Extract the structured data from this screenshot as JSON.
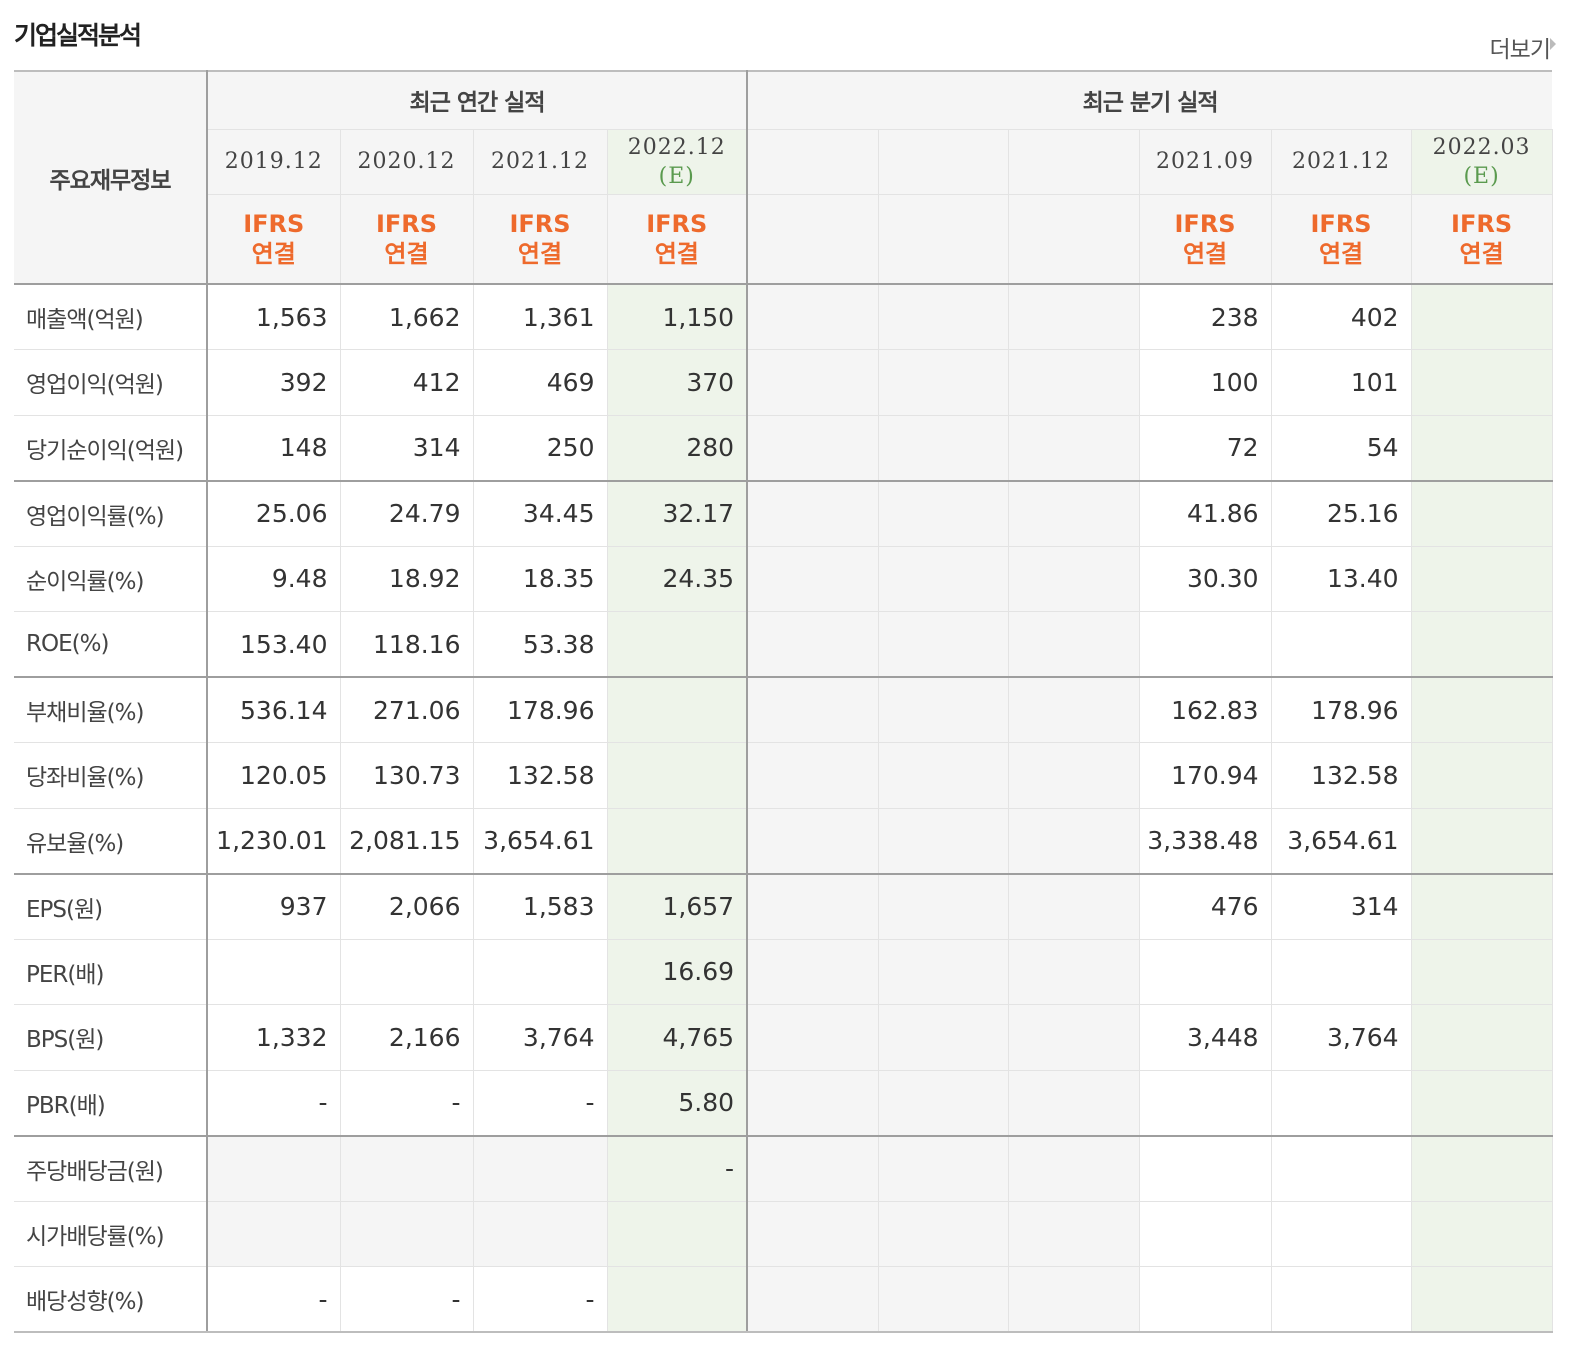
{
  "title": "기업실적분석",
  "more_label": "더보기",
  "header": {
    "corner": "주요재무정보",
    "annual_group": "최근 연간 실적",
    "quarter_group": "최근 분기 실적",
    "annual_dates": [
      {
        "date": "2019.12",
        "tag": ""
      },
      {
        "date": "2020.12",
        "tag": ""
      },
      {
        "date": "2021.12",
        "tag": ""
      },
      {
        "date": "2022.12",
        "tag": "(E)"
      }
    ],
    "quarter_dates": [
      {
        "date": "",
        "tag": ""
      },
      {
        "date": "",
        "tag": ""
      },
      {
        "date": "",
        "tag": ""
      },
      {
        "date": "2021.09",
        "tag": ""
      },
      {
        "date": "2021.12",
        "tag": ""
      },
      {
        "date": "2022.03",
        "tag": "(E)"
      }
    ],
    "ifrs_line1": "IFRS",
    "ifrs_line2": "연결"
  },
  "rows": [
    {
      "label": "매출액(억원)",
      "annual": [
        "1,563",
        "1,662",
        "1,361",
        "1,150"
      ],
      "quarter": [
        "",
        "",
        "",
        "238",
        "402",
        ""
      ]
    },
    {
      "label": "영업이익(억원)",
      "annual": [
        "392",
        "412",
        "469",
        "370"
      ],
      "quarter": [
        "",
        "",
        "",
        "100",
        "101",
        ""
      ]
    },
    {
      "label": "당기순이익(억원)",
      "annual": [
        "148",
        "314",
        "250",
        "280"
      ],
      "quarter": [
        "",
        "",
        "",
        "72",
        "54",
        ""
      ]
    },
    {
      "label": "영업이익률(%)",
      "annual": [
        "25.06",
        "24.79",
        "34.45",
        "32.17"
      ],
      "quarter": [
        "",
        "",
        "",
        "41.86",
        "25.16",
        ""
      ]
    },
    {
      "label": "순이익률(%)",
      "annual": [
        "9.48",
        "18.92",
        "18.35",
        "24.35"
      ],
      "quarter": [
        "",
        "",
        "",
        "30.30",
        "13.40",
        ""
      ]
    },
    {
      "label": "ROE(%)",
      "annual": [
        "153.40",
        "118.16",
        "53.38",
        ""
      ],
      "quarter": [
        "",
        "",
        "",
        "",
        "",
        ""
      ]
    },
    {
      "label": "부채비율(%)",
      "annual": [
        "536.14",
        "271.06",
        "178.96",
        ""
      ],
      "quarter": [
        "",
        "",
        "",
        "162.83",
        "178.96",
        ""
      ]
    },
    {
      "label": "당좌비율(%)",
      "annual": [
        "120.05",
        "130.73",
        "132.58",
        ""
      ],
      "quarter": [
        "",
        "",
        "",
        "170.94",
        "132.58",
        ""
      ]
    },
    {
      "label": "유보율(%)",
      "annual": [
        "1,230.01",
        "2,081.15",
        "3,654.61",
        ""
      ],
      "quarter": [
        "",
        "",
        "",
        "3,338.48",
        "3,654.61",
        ""
      ]
    },
    {
      "label": "EPS(원)",
      "annual": [
        "937",
        "2,066",
        "1,583",
        "1,657"
      ],
      "quarter": [
        "",
        "",
        "",
        "476",
        "314",
        ""
      ]
    },
    {
      "label": "PER(배)",
      "annual": [
        "",
        "",
        "",
        "16.69"
      ],
      "quarter": [
        "",
        "",
        "",
        "",
        "",
        ""
      ]
    },
    {
      "label": "BPS(원)",
      "annual": [
        "1,332",
        "2,166",
        "3,764",
        "4,765"
      ],
      "quarter": [
        "",
        "",
        "",
        "3,448",
        "3,764",
        ""
      ]
    },
    {
      "label": "PBR(배)",
      "annual": [
        "-",
        "-",
        "-",
        "5.80"
      ],
      "quarter": [
        "",
        "",
        "",
        "",
        "",
        ""
      ]
    },
    {
      "label": "주당배당금(원)",
      "annual": [
        "",
        "",
        "",
        "-"
      ],
      "quarter": [
        "",
        "",
        "",
        "",
        "",
        ""
      ]
    },
    {
      "label": "시가배당률(%)",
      "annual": [
        "",
        "",
        "",
        ""
      ],
      "quarter": [
        "",
        "",
        "",
        "",
        "",
        ""
      ]
    },
    {
      "label": "배당성향(%)",
      "annual": [
        "-",
        "-",
        "-",
        ""
      ],
      "quarter": [
        "",
        "",
        "",
        "",
        "",
        ""
      ]
    }
  ],
  "colors": {
    "ifrs": "#ee6a2c",
    "estimate_bg": "#eef4ea",
    "estimate_tag": "#5a9a4e",
    "header_bg": "#f5f5f5"
  }
}
